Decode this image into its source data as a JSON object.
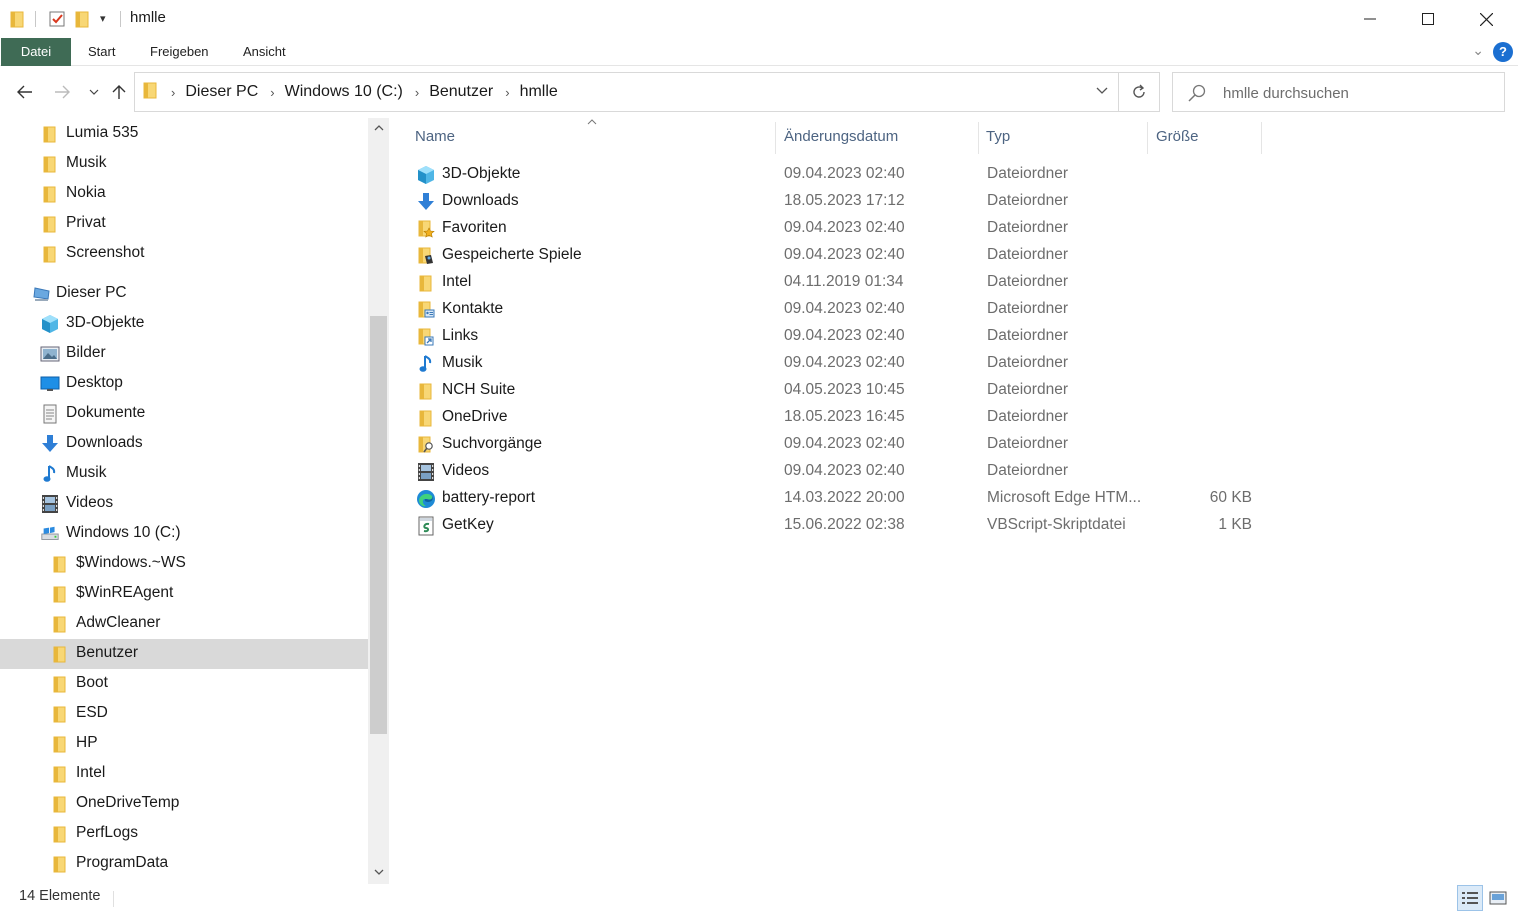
{
  "window": {
    "title": "hmlle",
    "minimize_icon": "minimize-icon",
    "maximize_icon": "maximize-icon",
    "close_icon": "close-icon"
  },
  "ribbon": {
    "tabs": [
      "Datei",
      "Start",
      "Freigeben",
      "Ansicht"
    ],
    "help_label": "?"
  },
  "nav": {
    "breadcrumb": [
      "Dieser PC",
      "Windows 10 (C:)",
      "Benutzer",
      "hmlle"
    ],
    "search_placeholder": "hmlle durchsuchen"
  },
  "sidebar": {
    "items": [
      {
        "label": "Lumia 535",
        "icon": "folder-icon",
        "indent": 1
      },
      {
        "label": "Musik",
        "icon": "folder-icon",
        "indent": 1
      },
      {
        "label": "Nokia",
        "icon": "folder-icon",
        "indent": 1
      },
      {
        "label": "Privat",
        "icon": "folder-icon",
        "indent": 1
      },
      {
        "label": "Screenshot",
        "icon": "folder-icon",
        "indent": 1
      },
      {
        "label": "Dieser PC",
        "icon": "computer-icon",
        "indent": 0
      },
      {
        "label": "3D-Objekte",
        "icon": "cube-icon",
        "indent": 1
      },
      {
        "label": "Bilder",
        "icon": "pictures-icon",
        "indent": 1
      },
      {
        "label": "Desktop",
        "icon": "desktop-icon",
        "indent": 1
      },
      {
        "label": "Dokumente",
        "icon": "documents-icon",
        "indent": 1
      },
      {
        "label": "Downloads",
        "icon": "download-icon",
        "indent": 1
      },
      {
        "label": "Musik",
        "icon": "music-icon",
        "indent": 1
      },
      {
        "label": "Videos",
        "icon": "video-icon",
        "indent": 1
      },
      {
        "label": "Windows 10 (C:)",
        "icon": "drive-icon",
        "indent": 1
      },
      {
        "label": "$Windows.~WS",
        "icon": "folder-icon",
        "indent": 2
      },
      {
        "label": "$WinREAgent",
        "icon": "folder-icon",
        "indent": 2
      },
      {
        "label": "AdwCleaner",
        "icon": "folder-icon",
        "indent": 2
      },
      {
        "label": "Benutzer",
        "icon": "folder-icon",
        "indent": 2,
        "selected": true
      },
      {
        "label": "Boot",
        "icon": "folder-icon",
        "indent": 2
      },
      {
        "label": "ESD",
        "icon": "folder-icon",
        "indent": 2
      },
      {
        "label": "HP",
        "icon": "folder-icon",
        "indent": 2
      },
      {
        "label": "Intel",
        "icon": "folder-icon",
        "indent": 2
      },
      {
        "label": "OneDriveTemp",
        "icon": "folder-icon",
        "indent": 2
      },
      {
        "label": "PerfLogs",
        "icon": "folder-icon",
        "indent": 2
      },
      {
        "label": "ProgramData",
        "icon": "folder-icon",
        "indent": 2
      }
    ]
  },
  "columns": {
    "name": "Name",
    "date": "Änderungsdatum",
    "type": "Typ",
    "size": "Größe"
  },
  "files": [
    {
      "name": "3D-Objekte",
      "date": "09.04.2023 02:40",
      "type": "Dateiordner",
      "size": "",
      "icon": "cube-icon"
    },
    {
      "name": "Downloads",
      "date": "18.05.2023 17:12",
      "type": "Dateiordner",
      "size": "",
      "icon": "download-icon"
    },
    {
      "name": "Favoriten",
      "date": "09.04.2023 02:40",
      "type": "Dateiordner",
      "size": "",
      "icon": "favorites-folder-icon"
    },
    {
      "name": "Gespeicherte Spiele",
      "date": "09.04.2023 02:40",
      "type": "Dateiordner",
      "size": "",
      "icon": "saved-games-icon"
    },
    {
      "name": "Intel",
      "date": "04.11.2019 01:34",
      "type": "Dateiordner",
      "size": "",
      "icon": "folder-icon"
    },
    {
      "name": "Kontakte",
      "date": "09.04.2023 02:40",
      "type": "Dateiordner",
      "size": "",
      "icon": "contacts-icon"
    },
    {
      "name": "Links",
      "date": "09.04.2023 02:40",
      "type": "Dateiordner",
      "size": "",
      "icon": "links-icon"
    },
    {
      "name": "Musik",
      "date": "09.04.2023 02:40",
      "type": "Dateiordner",
      "size": "",
      "icon": "music-icon"
    },
    {
      "name": "NCH Suite",
      "date": "04.05.2023 10:45",
      "type": "Dateiordner",
      "size": "",
      "icon": "folder-icon"
    },
    {
      "name": "OneDrive",
      "date": "18.05.2023 16:45",
      "type": "Dateiordner",
      "size": "",
      "icon": "folder-icon"
    },
    {
      "name": "Suchvorgänge",
      "date": "09.04.2023 02:40",
      "type": "Dateiordner",
      "size": "",
      "icon": "searches-icon"
    },
    {
      "name": "Videos",
      "date": "09.04.2023 02:40",
      "type": "Dateiordner",
      "size": "",
      "icon": "video-icon"
    },
    {
      "name": "battery-report",
      "date": "14.03.2022 20:00",
      "type": "Microsoft Edge HTM...",
      "size": "60 KB",
      "icon": "edge-icon"
    },
    {
      "name": "GetKey",
      "date": "15.06.2022 02:38",
      "type": "VBScript-Skriptdatei",
      "size": "1 KB",
      "icon": "script-icon"
    }
  ],
  "status": {
    "count_text": "14 Elemente"
  },
  "colors": {
    "folder": "#f8d775",
    "folder_dark": "#e8b73b",
    "accent": "#1b6fd1",
    "header_text": "#4d6482",
    "selected_bg": "#d9d9d9"
  }
}
